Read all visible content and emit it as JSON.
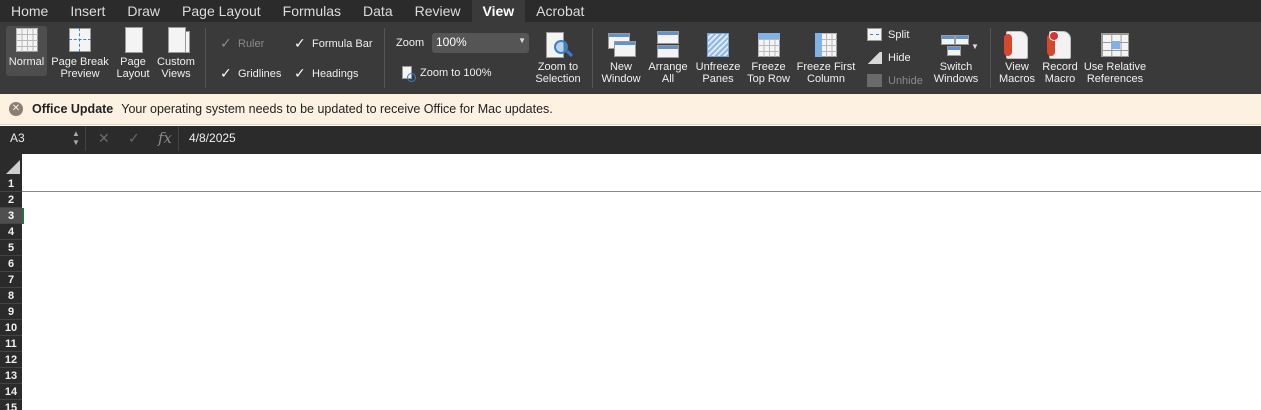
{
  "tabs": [
    "Home",
    "Insert",
    "Draw",
    "Page Layout",
    "Formulas",
    "Data",
    "Review",
    "View",
    "Acrobat"
  ],
  "active_tab": "View",
  "ribbon": {
    "workbook_views": {
      "normal": "Normal",
      "page_break_preview": [
        "Page Break",
        "Preview"
      ],
      "page_layout": [
        "Page",
        "Layout"
      ],
      "custom_views": [
        "Custom",
        "Views"
      ]
    },
    "show": {
      "ruler": "Ruler",
      "formula_bar": "Formula Bar",
      "gridlines": "Gridlines",
      "headings": "Headings",
      "ruler_checked": true,
      "formula_bar_checked": true,
      "gridlines_checked": true,
      "headings_checked": true
    },
    "zoom": {
      "label": "Zoom",
      "value": "100%",
      "zoom_to_100": "Zoom to 100%",
      "zoom_to_selection": [
        "Zoom to",
        "Selection"
      ]
    },
    "window": {
      "new_window": [
        "New",
        "Window"
      ],
      "arrange_all": [
        "Arrange",
        "All"
      ],
      "unfreeze_panes": [
        "Unfreeze",
        "Panes"
      ],
      "freeze_top_row": [
        "Freeze",
        "Top Row"
      ],
      "freeze_first_column": [
        "Freeze First",
        "Column"
      ],
      "split": "Split",
      "hide": "Hide",
      "unhide": "Unhide",
      "switch_windows": [
        "Switch",
        "Windows"
      ]
    },
    "macros": {
      "view_macros": [
        "View",
        "Macros"
      ],
      "record_macro": [
        "Record",
        "Macro"
      ],
      "use_relative_references": [
        "Use Relative",
        "References"
      ]
    }
  },
  "update_bar": {
    "title": "Office Update",
    "message": "Your operating system needs to be updated to receive Office for Mac updates."
  },
  "formula_bar": {
    "name_box": "A3",
    "cancel_icon": "✕",
    "enter_icon": "✓",
    "fx_label": "fx",
    "value": "4/8/2025"
  },
  "rows": [
    "1",
    "2",
    "3",
    "4",
    "5",
    "6",
    "7",
    "8",
    "9",
    "10",
    "11",
    "12",
    "13",
    "14",
    "15"
  ],
  "selected_row": "3",
  "colors": {
    "ribbon_bg": "#3a3a3a",
    "tab_bg": "#2b2b2b",
    "update_bar_bg": "#fdf1e1",
    "selection_green": "#217346"
  }
}
